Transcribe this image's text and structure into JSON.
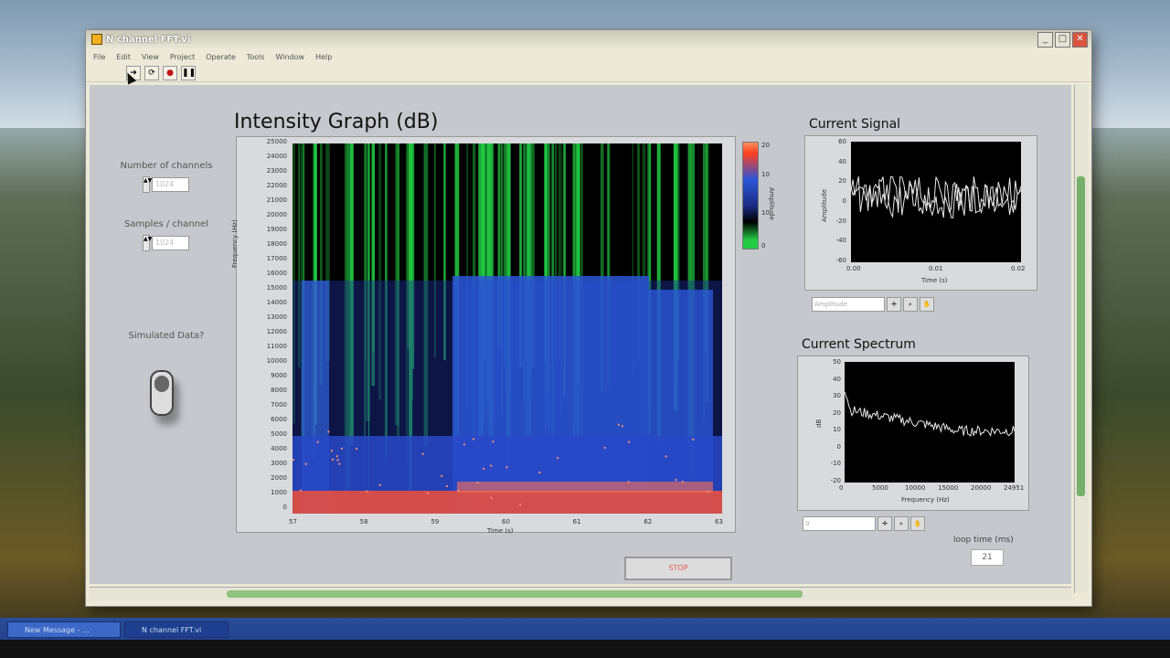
{
  "window": {
    "title": "N channel FFT.vi",
    "menu": [
      "File",
      "Edit",
      "View",
      "Project",
      "Operate",
      "Tools",
      "Window",
      "Help"
    ],
    "toolbar_icons": [
      "run-arrow-icon",
      "run-continuous-icon",
      "abort-icon",
      "pause-icon"
    ]
  },
  "controls": {
    "num_channels": {
      "label": "Number of channels",
      "value": "1024"
    },
    "samples_per_channel": {
      "label": "Samples / channel",
      "value": "1024"
    },
    "simulated": {
      "label": "Simulated Data?"
    },
    "stop_label": "STOP",
    "loop_time_label": "loop time (ms)",
    "loop_time_value": "21"
  },
  "intensity_graph": {
    "title": "Intensity Graph (dB)",
    "xlabel": "Time (s)",
    "ylabel": "Frequency (Hz)",
    "colorbar_label": "Amplitude",
    "colorbar_ticks": [
      "20",
      "10",
      "10",
      "0"
    ],
    "x_ticks": [
      "57",
      "58",
      "59",
      "60",
      "61",
      "62",
      "63"
    ],
    "y_ticks": [
      "25000",
      "24000",
      "23000",
      "22000",
      "21000",
      "20000",
      "19000",
      "18000",
      "17000",
      "16000",
      "15000",
      "14000",
      "13000",
      "12000",
      "11000",
      "10000",
      "9000",
      "8000",
      "7000",
      "6000",
      "5000",
      "4000",
      "3000",
      "2000",
      "1000",
      "0"
    ]
  },
  "signal_graph": {
    "title": "Current Signal",
    "xlabel": "Time (s)",
    "ylabel": "Amplitude",
    "x_ticks": [
      "0.00",
      "0.01",
      "0.02"
    ],
    "y_ticks": [
      "60",
      "40",
      "20",
      "0",
      "-20",
      "-40",
      "-60"
    ],
    "control_text": "Amplitude"
  },
  "spectrum_graph": {
    "title": "Current Spectrum",
    "xlabel": "Frequency (Hz)",
    "ylabel": "dB",
    "x_ticks": [
      "0",
      "5000",
      "10000",
      "15000",
      "20000",
      "24951"
    ],
    "y_ticks": [
      "50",
      "40",
      "30",
      "20",
      "10",
      "0",
      "-10",
      "-20"
    ],
    "control_text": "0"
  },
  "taskbar": {
    "items": [
      "New Message - ...",
      "N channel FFT.vi"
    ]
  },
  "colors": {
    "panel": "#c5c8cc",
    "plot_bg": "#000000",
    "spec_green": "#22cc44",
    "spec_blue": "#2a56d8",
    "spec_red": "#ff5030"
  }
}
